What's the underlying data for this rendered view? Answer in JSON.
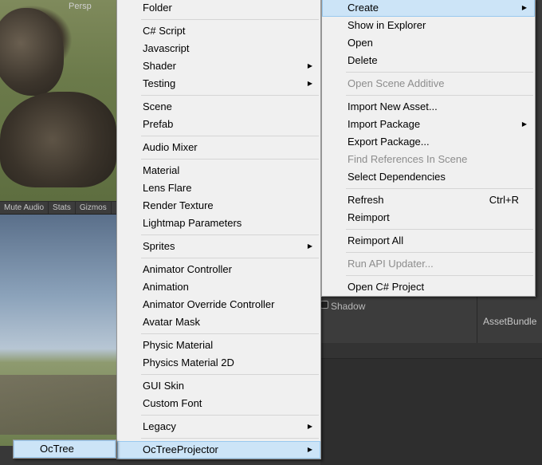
{
  "scene": {
    "view_label": "Persp",
    "toolbar": [
      "Mute Audio",
      "Stats",
      "Gizmos"
    ]
  },
  "inspector": {
    "shadow_label": "Shadow",
    "assetbundle_label": "AssetBundle"
  },
  "main_menu": {
    "items": [
      {
        "label": "Create",
        "submenu": true,
        "highlighted": true
      },
      {
        "label": "Show in Explorer"
      },
      {
        "label": "Open"
      },
      {
        "label": "Delete"
      },
      {
        "separator": true
      },
      {
        "label": "Open Scene Additive",
        "disabled": true
      },
      {
        "separator": true
      },
      {
        "label": "Import New Asset..."
      },
      {
        "label": "Import Package",
        "submenu": true
      },
      {
        "label": "Export Package..."
      },
      {
        "label": "Find References In Scene",
        "disabled": true
      },
      {
        "label": "Select Dependencies"
      },
      {
        "separator": true
      },
      {
        "label": "Refresh",
        "shortcut": "Ctrl+R"
      },
      {
        "label": "Reimport"
      },
      {
        "separator": true
      },
      {
        "label": "Reimport All"
      },
      {
        "separator": true
      },
      {
        "label": "Run API Updater...",
        "disabled": true
      },
      {
        "separator": true
      },
      {
        "label": "Open C# Project"
      }
    ]
  },
  "create_menu": {
    "items": [
      {
        "label": "Folder"
      },
      {
        "separator": true
      },
      {
        "label": "C# Script"
      },
      {
        "label": "Javascript"
      },
      {
        "label": "Shader",
        "submenu": true
      },
      {
        "label": "Testing",
        "submenu": true
      },
      {
        "separator": true
      },
      {
        "label": "Scene"
      },
      {
        "label": "Prefab"
      },
      {
        "separator": true
      },
      {
        "label": "Audio Mixer"
      },
      {
        "separator": true
      },
      {
        "label": "Material"
      },
      {
        "label": "Lens Flare"
      },
      {
        "label": "Render Texture"
      },
      {
        "label": "Lightmap Parameters"
      },
      {
        "separator": true
      },
      {
        "label": "Sprites",
        "submenu": true
      },
      {
        "separator": true
      },
      {
        "label": "Animator Controller"
      },
      {
        "label": "Animation"
      },
      {
        "label": "Animator Override Controller"
      },
      {
        "label": "Avatar Mask"
      },
      {
        "separator": true
      },
      {
        "label": "Physic Material"
      },
      {
        "label": "Physics Material 2D"
      },
      {
        "separator": true
      },
      {
        "label": "GUI Skin"
      },
      {
        "label": "Custom Font"
      },
      {
        "separator": true
      },
      {
        "label": "Legacy",
        "submenu": true
      },
      {
        "separator": true
      },
      {
        "label": "OcTreeProjector",
        "submenu": true,
        "highlighted": true
      }
    ]
  },
  "octree_menu": {
    "items": [
      {
        "label": "OcTree",
        "highlighted": true
      }
    ]
  },
  "icons": {
    "submenu_arrow": "triangle-right-icon"
  }
}
